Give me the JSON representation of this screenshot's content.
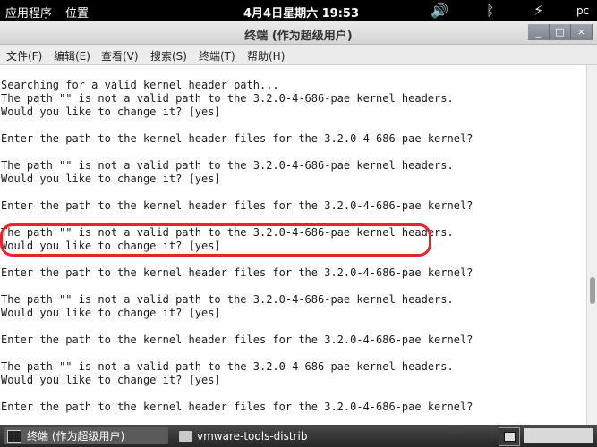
{
  "top_panel": {
    "apps_label": "应用程序",
    "places_label": "位置",
    "clock": "4月4日星期六 19:53",
    "volume_icon": "volume-icon",
    "bluetooth_icon": "bluetooth-icon",
    "network_icon": "network-icon",
    "user_label": "pc"
  },
  "window": {
    "title": "终端 (作为超级用户)",
    "buttons": [
      "_",
      "□",
      "×"
    ]
  },
  "menubar": [
    "文件(F)",
    "编辑(E)",
    "查看(V)",
    "搜索(S)",
    "终端(T)",
    "帮助(H)"
  ],
  "terminal": {
    "lines": [
      "",
      "Searching for a valid kernel header path...",
      "The path \"\" is not a valid path to the 3.2.0-4-686-pae kernel headers.",
      "Would you like to change it? [yes]",
      "",
      "Enter the path to the kernel header files for the 3.2.0-4-686-pae kernel?",
      "",
      "The path \"\" is not a valid path to the 3.2.0-4-686-pae kernel headers.",
      "Would you like to change it? [yes]",
      "",
      "Enter the path to the kernel header files for the 3.2.0-4-686-pae kernel?",
      "",
      "The path \"\" is not a valid path to the 3.2.0-4-686-pae kernel headers.",
      "Would you like to change it? [yes]",
      "",
      "Enter the path to the kernel header files for the 3.2.0-4-686-pae kernel?",
      "",
      "The path \"\" is not a valid path to the 3.2.0-4-686-pae kernel headers.",
      "Would you like to change it? [yes]",
      "",
      "Enter the path to the kernel header files for the 3.2.0-4-686-pae kernel?",
      "",
      "The path \"\" is not a valid path to the 3.2.0-4-686-pae kernel headers.",
      "Would you like to change it? [yes]",
      "",
      "Enter the path to the kernel header files for the 3.2.0-4-686-pae kernel?"
    ],
    "highlight_color": "#e8232a"
  },
  "taskbar": {
    "items": [
      {
        "label": "终端 (作为超级用户)",
        "icon": "terminal-icon",
        "active": true
      },
      {
        "label": "vmware-tools-distrib",
        "icon": "folder-icon",
        "active": false
      }
    ],
    "tray_icon": "terminal-icon"
  }
}
